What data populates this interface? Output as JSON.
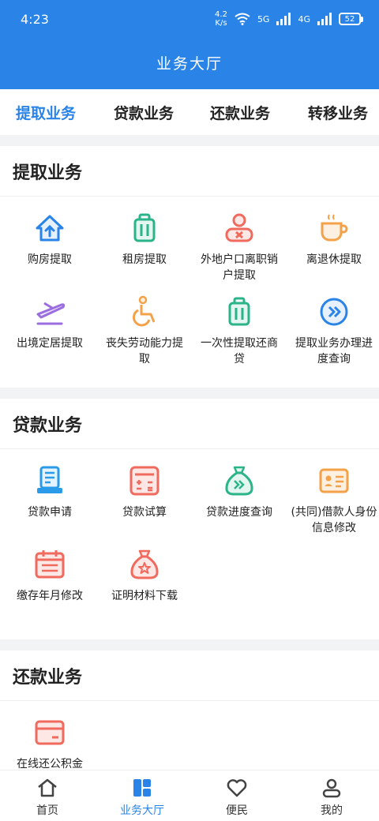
{
  "status": {
    "time": "4:23",
    "speed_value": "4.2",
    "speed_unit": "K/s",
    "net1": "5G",
    "net2": "4G",
    "battery": "52"
  },
  "app": {
    "title": "业务大厅"
  },
  "tabs": [
    {
      "label": "提取业务",
      "active": true
    },
    {
      "label": "贷款业务",
      "active": false
    },
    {
      "label": "还款业务",
      "active": false
    },
    {
      "label": "转移业务",
      "active": false
    }
  ],
  "sections": [
    {
      "title": "提取业务",
      "items": [
        {
          "label": "购房提取",
          "icon": "house-upload-icon",
          "color": "#2a84e8"
        },
        {
          "label": "租房提取",
          "icon": "luggage-icon",
          "color": "#2bb38a"
        },
        {
          "label": "外地户口离职销户提取",
          "icon": "user-remove-icon",
          "color": "#f06a5e"
        },
        {
          "label": "离退休提取",
          "icon": "coffee-cup-icon",
          "color": "#f4a24a"
        },
        {
          "label": "出境定居提取",
          "icon": "airplane-icon",
          "color": "#9b6ee0"
        },
        {
          "label": "丧失劳动能力提取",
          "icon": "wheelchair-icon",
          "color": "#f4a24a"
        },
        {
          "label": "一次性提取还商贷",
          "icon": "luggage-icon",
          "color": "#2bb38a"
        },
        {
          "label": "提取业务办理进度查询",
          "icon": "forward-circle-icon",
          "color": "#2a84e8"
        }
      ]
    },
    {
      "title": "贷款业务",
      "items": [
        {
          "label": "贷款申请",
          "icon": "form-printer-icon",
          "color": "#2a9be8"
        },
        {
          "label": "贷款试算",
          "icon": "calculator-icon",
          "color": "#f06a5e"
        },
        {
          "label": "贷款进度查询",
          "icon": "money-bag-forward-icon",
          "color": "#2bb38a"
        },
        {
          "label": "(共同)借款人身份信息修改",
          "icon": "id-card-icon",
          "color": "#f4a24a"
        },
        {
          "label": "缴存年月修改",
          "icon": "calendar-icon",
          "color": "#f06a5e"
        },
        {
          "label": "证明材料下载",
          "icon": "money-bag-star-icon",
          "color": "#f06a5e"
        }
      ]
    },
    {
      "title": "还款业务",
      "items": [
        {
          "label": "在线还公积金",
          "icon": "credit-card-icon",
          "color": "#f06a5e"
        }
      ]
    }
  ],
  "nav": [
    {
      "label": "首页",
      "icon": "home-icon",
      "active": false
    },
    {
      "label": "业务大厅",
      "icon": "grid-icon",
      "active": true
    },
    {
      "label": "便民",
      "icon": "heart-icon",
      "active": false
    },
    {
      "label": "我的",
      "icon": "user-icon",
      "active": false
    }
  ]
}
